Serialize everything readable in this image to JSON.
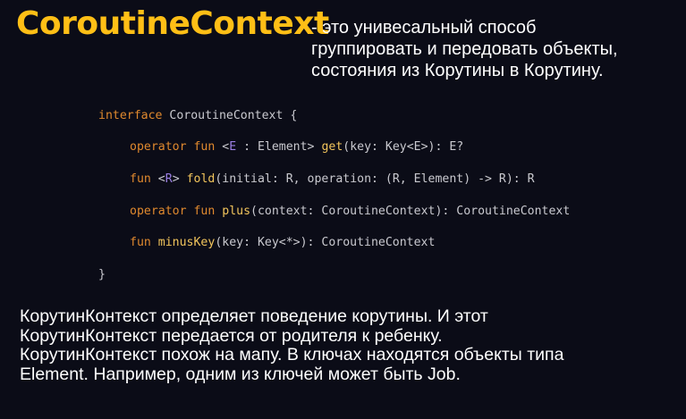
{
  "slide": {
    "title": "CoroutineContext",
    "subtitle_lines": [
      "- это унивесальный способ",
      "группировать и передовать объекты,",
      "состояния из Корутины в Корутину."
    ],
    "code": {
      "line0": {
        "kw_interface": "interface",
        "name": " CoroutineContext {"
      },
      "line1": {
        "kw_operator": "operator",
        "kw_fun": " fun",
        "sp": " ",
        "lt": "<",
        "gen": "E",
        "mid": " : Element> ",
        "fname": "get",
        "rest": "(key: Key<E>): E?"
      },
      "line2": {
        "kw_fun": "fun",
        "sp": " ",
        "lt": "<",
        "gen": "R",
        "gt": "> ",
        "fname": "fold",
        "rest": "(initial: R, operation: (R, Element) -> R): R"
      },
      "line3": {
        "kw_operator": "operator",
        "kw_fun": " fun",
        "sp": " ",
        "fname": "plus",
        "rest": "(context: CoroutineContext): CoroutineContext"
      },
      "line4": {
        "kw_fun": "fun",
        "sp": " ",
        "fname": "minusKey",
        "rest": "(key: Key<*>): CoroutineContext"
      },
      "line5": {
        "close": "}"
      }
    },
    "body_lines": [
      "КорутинКонтекст определяет поведение корутины. И этот",
      "КорутинКонтекст передается от родителя к ребенку.",
      "КорутинКонтекст похож на мапу. В ключах находятся объекты типа",
      "Element. Например, одним из ключей может быть Job."
    ]
  },
  "colors": {
    "background": "#0b0c17",
    "title": "#ffbf16",
    "keyword": "#e0892e",
    "function_name": "#f2c55c",
    "generic_param": "#9b7fe4",
    "code_text": "#c9c9cf",
    "text": "#ffffff"
  }
}
